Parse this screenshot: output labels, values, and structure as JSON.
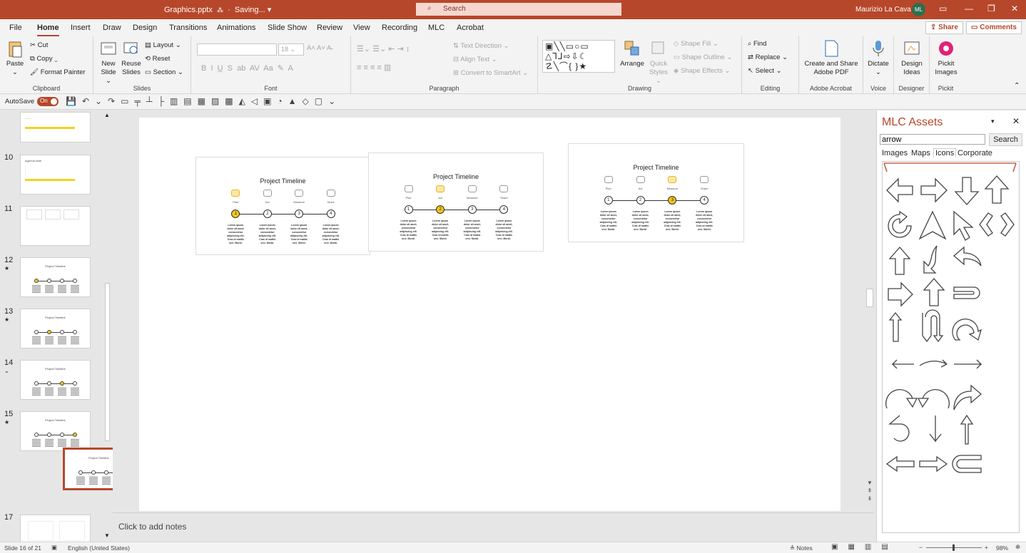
{
  "titlebar": {
    "filename": "Graphics.pptx",
    "saving": "Saving...",
    "search_placeholder": "Search",
    "user_name": "Maurizio La Cava",
    "user_initials": "ML",
    "accent": "#b7472a"
  },
  "menu": {
    "tabs": [
      "File",
      "Home",
      "Insert",
      "Draw",
      "Design",
      "Transitions",
      "Animations",
      "Slide Show",
      "Review",
      "View",
      "Recording",
      "MLC",
      "Acrobat"
    ],
    "active": "Home",
    "share": "Share",
    "comments": "Comments"
  },
  "ribbon": {
    "clipboard": {
      "paste": "Paste",
      "cut": "Cut",
      "copy": "Copy",
      "format_painter": "Format Painter",
      "label": "Clipboard"
    },
    "slides": {
      "new_slide_1": "New",
      "new_slide_2": "Slide",
      "reuse_1": "Reuse",
      "reuse_2": "Slides",
      "layout": "Layout",
      "reset": "Reset",
      "section": "Section",
      "label": "Slides"
    },
    "font": {
      "size": "18",
      "label": "Font"
    },
    "paragraph": {
      "text_direction": "Text Direction",
      "align_text": "Align Text",
      "convert_smartart": "Convert to SmartArt",
      "label": "Paragraph"
    },
    "drawing": {
      "arrange": "Arrange",
      "quick_1": "Quick",
      "quick_2": "Styles",
      "shape_fill": "Shape Fill",
      "shape_outline": "Shape Outline",
      "shape_effects": "Shape Effects",
      "label": "Drawing"
    },
    "editing": {
      "find": "Find",
      "replace": "Replace",
      "select": "Select",
      "label": "Editing"
    },
    "acrobat": {
      "create_1": "Create and Share",
      "create_2": "Adobe PDF",
      "label": "Adobe Acrobat"
    },
    "voice": {
      "dictate": "Dictate",
      "label": "Voice"
    },
    "designer": {
      "ideas_1": "Design",
      "ideas_2": "Ideas",
      "label": "Designer"
    },
    "pickit": {
      "images_1": "Pickit",
      "images_2": "Images",
      "label": "Pickit"
    }
  },
  "qat": {
    "autosave": "AutoSave",
    "toggle": "On"
  },
  "thumbnails": {
    "numbers": [
      "10",
      "11",
      "12",
      "13",
      "14",
      "15",
      "17"
    ],
    "slide10_title": "Agenda slide",
    "drag_title": "Project Timeline"
  },
  "slide": {
    "cards": [
      {
        "title": "Project Timeline",
        "active_step": 1
      },
      {
        "title": "Project Timeline",
        "active_step": 2
      },
      {
        "title": "Project Timeline",
        "active_step": 3
      }
    ],
    "steps": [
      "Plan",
      "Act",
      "Measure",
      "Share"
    ],
    "step_numbers": [
      "1",
      "2",
      "3",
      "4"
    ],
    "body_lines": [
      "Lorem ipsum",
      "dolor sit amet,",
      "consectetur",
      "adipiscing elit.",
      "Cras id mattis",
      "orci. Morbi."
    ]
  },
  "notes": {
    "placeholder": "Click to add notes"
  },
  "assets": {
    "title": "MLC Assets",
    "search_value": "arrow",
    "search_button": "Search",
    "tabs": [
      "Images",
      "Maps",
      "Icons",
      "Corporate"
    ],
    "active_tab": "Icons"
  },
  "status": {
    "slide_info": "Slide 16 of 21",
    "language": "English (United States)",
    "notes": "Notes",
    "zoom": "98%"
  }
}
